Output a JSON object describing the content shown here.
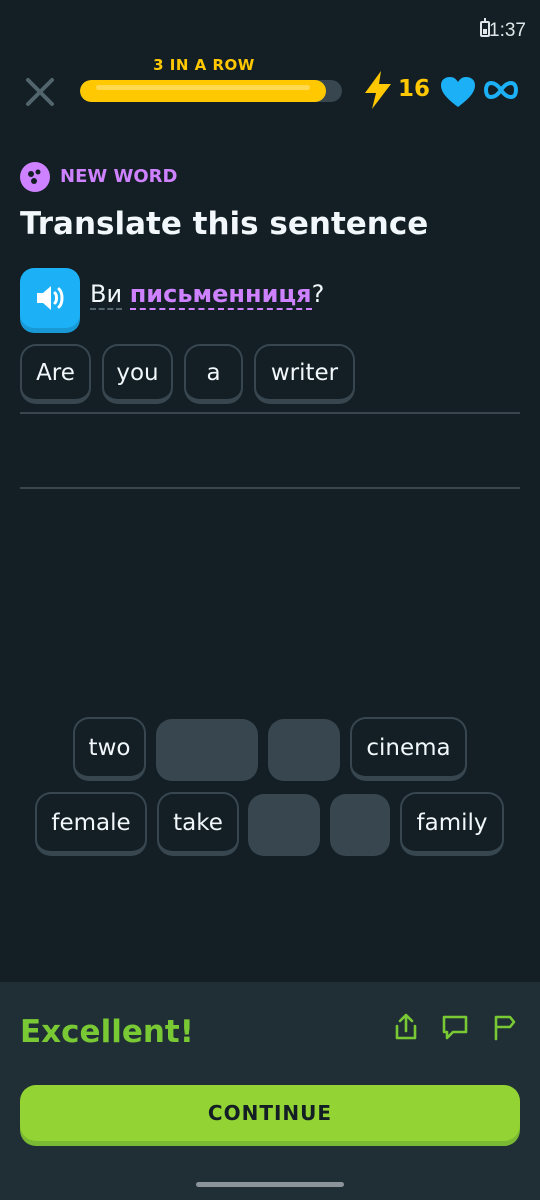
{
  "status_bar": {
    "time": "1:37"
  },
  "header": {
    "streak_label": "3 IN A ROW",
    "progress": 0.94,
    "energy_count": "16",
    "hearts": "∞"
  },
  "lesson": {
    "tag": "NEW WORD",
    "title": "Translate this sentence",
    "sentence_word1": "Ви",
    "sentence_word2": "письменниця",
    "sentence_punct": "?",
    "answer_chips": [
      "Are",
      "you",
      "a",
      "writer"
    ],
    "bank_row1": [
      "two",
      "",
      "",
      "cinema"
    ],
    "bank_row2": [
      "female",
      "take",
      "",
      "",
      "family"
    ]
  },
  "footer": {
    "result": "Excellent!",
    "continue_label": "CONTINUE"
  },
  "colors": {
    "background": "#131f24",
    "accent_purple": "#ce82ff",
    "streak_yellow": "#ffc800",
    "heart_blue": "#1cb0f6",
    "success_green": "#93d333"
  }
}
